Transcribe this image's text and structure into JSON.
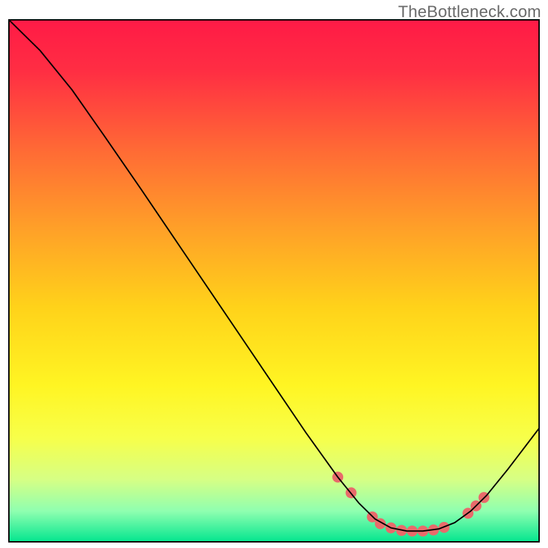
{
  "attribution": {
    "text": "TheBottleneck.com"
  },
  "chart_data": {
    "type": "line",
    "title": "",
    "xlabel": "",
    "ylabel": "",
    "xlim": [
      0,
      100
    ],
    "ylim": [
      0,
      100
    ],
    "background_gradient": {
      "stops": [
        {
          "offset": 0.0,
          "color": "#ff1a46"
        },
        {
          "offset": 0.1,
          "color": "#ff2e43"
        },
        {
          "offset": 0.25,
          "color": "#ff6a35"
        },
        {
          "offset": 0.4,
          "color": "#ffa028"
        },
        {
          "offset": 0.55,
          "color": "#ffd21a"
        },
        {
          "offset": 0.7,
          "color": "#fff523"
        },
        {
          "offset": 0.8,
          "color": "#f7ff4a"
        },
        {
          "offset": 0.88,
          "color": "#d6ff85"
        },
        {
          "offset": 0.94,
          "color": "#8fffb0"
        },
        {
          "offset": 1.0,
          "color": "#00e58e"
        }
      ]
    },
    "curve": {
      "color": "#000000",
      "width": 2,
      "points": [
        {
          "x": 0.0,
          "y": 100.0
        },
        {
          "x": 6.0,
          "y": 94.0
        },
        {
          "x": 12.0,
          "y": 86.5
        },
        {
          "x": 18.0,
          "y": 77.8
        },
        {
          "x": 25.0,
          "y": 67.5
        },
        {
          "x": 32.0,
          "y": 57.0
        },
        {
          "x": 40.0,
          "y": 45.0
        },
        {
          "x": 48.0,
          "y": 33.0
        },
        {
          "x": 56.0,
          "y": 21.0
        },
        {
          "x": 62.0,
          "y": 12.5
        },
        {
          "x": 66.0,
          "y": 7.5
        },
        {
          "x": 69.0,
          "y": 4.5
        },
        {
          "x": 72.0,
          "y": 2.8
        },
        {
          "x": 75.0,
          "y": 2.2
        },
        {
          "x": 78.0,
          "y": 2.2
        },
        {
          "x": 81.0,
          "y": 2.6
        },
        {
          "x": 84.0,
          "y": 3.8
        },
        {
          "x": 87.0,
          "y": 6.0
        },
        {
          "x": 90.0,
          "y": 9.0
        },
        {
          "x": 94.0,
          "y": 14.0
        },
        {
          "x": 100.0,
          "y": 22.0
        }
      ]
    },
    "markers": {
      "color": "#e86b6b",
      "radius": 8,
      "points": [
        {
          "x": 62.0,
          "y": 12.5
        },
        {
          "x": 64.5,
          "y": 9.5
        },
        {
          "x": 68.5,
          "y": 4.9
        },
        {
          "x": 70.0,
          "y": 3.6
        },
        {
          "x": 72.0,
          "y": 2.8
        },
        {
          "x": 74.0,
          "y": 2.3
        },
        {
          "x": 76.0,
          "y": 2.2
        },
        {
          "x": 78.0,
          "y": 2.2
        },
        {
          "x": 80.0,
          "y": 2.4
        },
        {
          "x": 82.0,
          "y": 2.9
        },
        {
          "x": 86.5,
          "y": 5.6
        },
        {
          "x": 88.0,
          "y": 7.0
        },
        {
          "x": 89.5,
          "y": 8.6
        }
      ]
    }
  }
}
